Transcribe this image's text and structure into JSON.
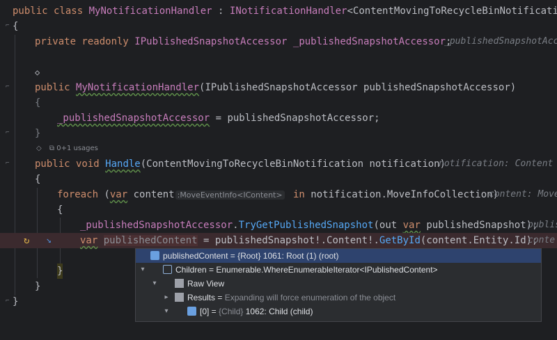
{
  "code": {
    "l1": {
      "kw": "public class",
      "name": "MyNotificationHandler",
      "colon": " : ",
      "iface": "INotificationHandler",
      "generic": "<ContentMovingToRecycleBinNotification>"
    },
    "l2": "{",
    "l3": {
      "kw": "private readonly",
      "type": "IPublishedSnapshotAccessor",
      "field": "_publishedSnapshotAccessor",
      "semi": ";",
      "hint": "_publishedSnapshotAcc"
    },
    "l4": "◇",
    "l5": {
      "kw": "public",
      "name": "MyNotificationHandler",
      "params": "(IPublishedSnapshotAccessor publishedSnapshotAccessor)"
    },
    "l6": "{",
    "l7": {
      "field": "_publishedSnapshotAccessor",
      "rest": " = publishedSnapshotAccessor;"
    },
    "l8": "}",
    "usages": "0+1 usages",
    "l9": {
      "kw": "public void",
      "name": "Handle",
      "params": "(ContentMovingToRecycleBinNotification notification)",
      "hint": "notification: Content"
    },
    "l10": "{",
    "l11": {
      "kw": "foreach",
      "open": " (",
      "var": "var",
      "ident": " content",
      "inlay": ":MoveEventInfo<IContent>",
      "in": " in ",
      "expr": "notification.MoveInfoCollection",
      "close": ")",
      "hint": "content: Move"
    },
    "l12": "{",
    "l13": {
      "field": "_publishedSnapshotAccessor",
      "dot": ".",
      "method": "TryGetPublishedSnapshot",
      "args": "(out ",
      "var": "var",
      "rest": " publishedSnapshot);",
      "hint": "publis"
    },
    "l14": {
      "var": "var",
      "ident": "publishedContent",
      "rest1": " = publishedSnapshot!.Content!.",
      "method": "GetById",
      "rest2": "(content.Entity.Id);",
      "hint": "conte"
    },
    "l15": "}",
    "l16": "}",
    "l17": "}"
  },
  "debugger": {
    "rows": [
      {
        "name": "publishedContent",
        "value": " = {Root} 1061: Root (1) (root)"
      },
      {
        "name": "Children",
        "value": " = Enumerable.WhereEnumerableIterator<IPublishedContent>"
      },
      {
        "name": "Raw View",
        "value": ""
      },
      {
        "name": "Results",
        "value": " = ",
        "note": "Expanding will force enumeration of the object"
      },
      {
        "name": "[0]",
        "value": " = ",
        "type": "{Child}",
        "rest": " 1062: Child (child)"
      }
    ]
  },
  "colors": {
    "background": "#1e1f22",
    "keyword": "#cf8e6d",
    "class": "#c77dbb",
    "method": "#56a8f5",
    "selection": "#214283",
    "popup": "#2b2d30"
  }
}
